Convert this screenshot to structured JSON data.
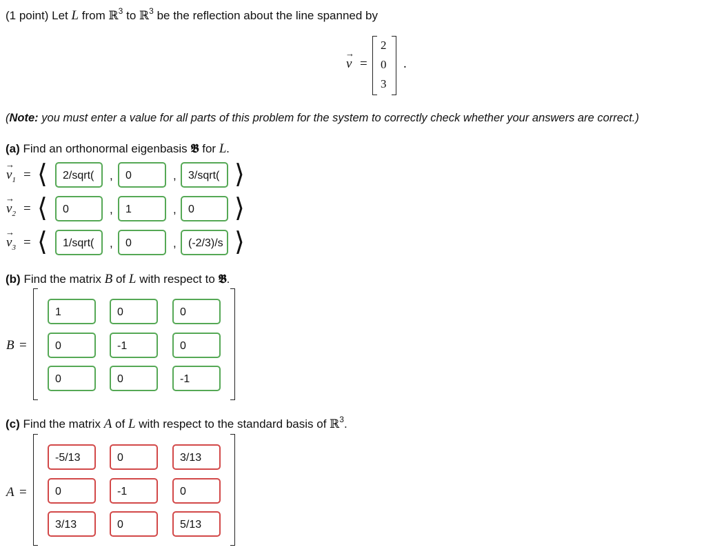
{
  "problem": {
    "points": "(1 point)",
    "intro_a": "Let",
    "L": "L",
    "from": "from",
    "R": "ℝ",
    "exp": "3",
    "to": "to",
    "tail": "be the reflection about the line spanned by",
    "v_label": "v",
    "equals": "=",
    "v_entries": [
      "2",
      "0",
      "3"
    ],
    "period": "."
  },
  "note": {
    "bold": "Note:",
    "rest": "you must enter a value for all parts of this problem for the system to correctly check whether your answers are correct.)",
    "open": "("
  },
  "part_a": {
    "label": "(a)",
    "text": "Find an orthonormal eigenbasis",
    "basis": "𝕭",
    "for": "for",
    "L": "L",
    "period": ".",
    "vectors": [
      {
        "sub": "1",
        "values": [
          "2/sqrt(",
          "0",
          "3/sqrt("
        ]
      },
      {
        "sub": "2",
        "values": [
          "0",
          "1",
          "0"
        ]
      },
      {
        "sub": "3",
        "values": [
          "1/sqrt(",
          "0",
          "(-2/3)/s"
        ]
      }
    ],
    "open_angle": "⟨",
    "close_angle": "⟩",
    "comma": ","
  },
  "part_b": {
    "label": "(b)",
    "text": "Find the matrix",
    "B": "B",
    "of": "of",
    "L": "L",
    "respect": "with respect to",
    "basis": "𝕭",
    "period": ".",
    "name": "B",
    "equals": "=",
    "matrix": [
      [
        "1",
        "0",
        "0"
      ],
      [
        "0",
        "-1",
        "0"
      ],
      [
        "0",
        "0",
        "-1"
      ]
    ]
  },
  "part_c": {
    "label": "(c)",
    "text": "Find the matrix",
    "A": "A",
    "of": "of",
    "L": "L",
    "respect": "with respect to the standard basis of",
    "R": "ℝ",
    "exp": "3",
    "period": ".",
    "name": "A",
    "equals": "=",
    "matrix": [
      [
        "-5/13",
        "0",
        "3/13"
      ],
      [
        "0",
        "-1",
        "0"
      ],
      [
        "3/13",
        "0",
        "5/13"
      ]
    ]
  },
  "colors": {
    "correct_border": "#55a855",
    "incorrect_border": "#d24848"
  }
}
